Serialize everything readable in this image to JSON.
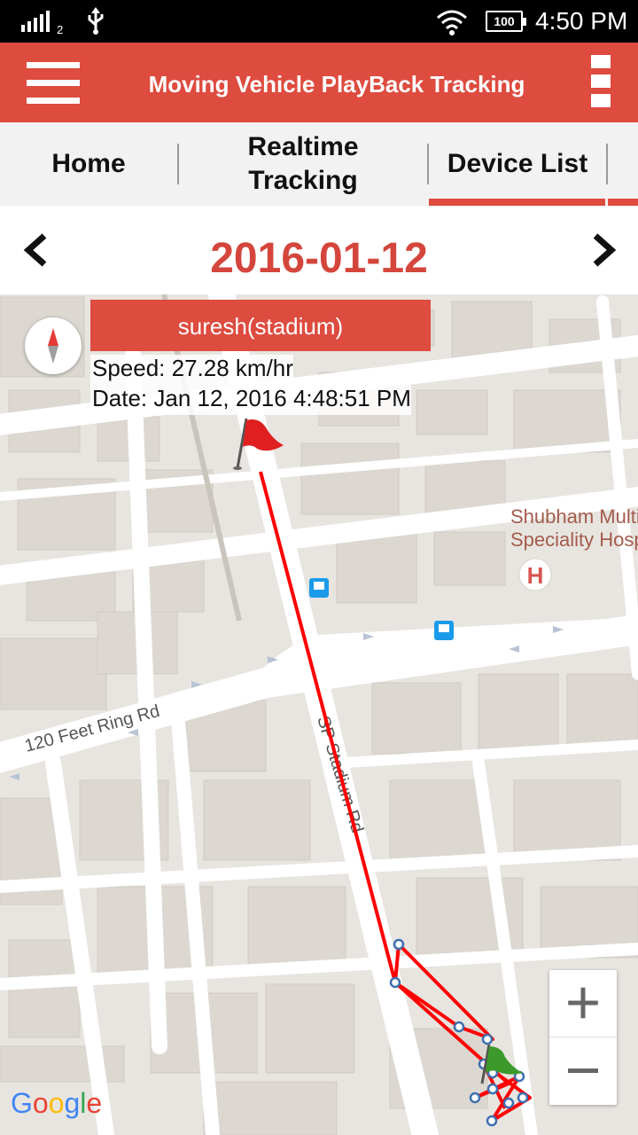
{
  "status_bar": {
    "sim_slot": "2",
    "battery": "100",
    "time": "4:50 PM"
  },
  "app_bar": {
    "title": "Moving Vehicle PlayBack Tracking",
    "menu_icon": "hamburger-menu-icon",
    "overflow_icon": "overflow-menu-icon"
  },
  "tabs": [
    {
      "label": "Home",
      "selected": false
    },
    {
      "label": "Realtime Tracking",
      "selected": false
    },
    {
      "label": "Device List",
      "selected": true
    }
  ],
  "date_nav": {
    "date": "2016-01-12",
    "prev_icon": "chevron-left-icon",
    "next_icon": "chevron-right-icon"
  },
  "info_window": {
    "name": "suresh(stadium)",
    "speed": "Speed: 27.28 km/hr",
    "date": "Date: Jan 12, 2016 4:48:51 PM"
  },
  "map": {
    "roads": [
      "120 Feet Ring Rd",
      "SP Stadium Rd"
    ],
    "poi": [
      "Shubham Multi",
      "Speciality Hosp"
    ],
    "hospital_marker": "H",
    "attribution": "Google",
    "route_color": "#ff0000"
  },
  "zoom": {
    "in_icon": "plus-icon",
    "out_icon": "minus-icon"
  },
  "colors": {
    "accent": "#de4b3f",
    "date_text": "#d4463c"
  }
}
